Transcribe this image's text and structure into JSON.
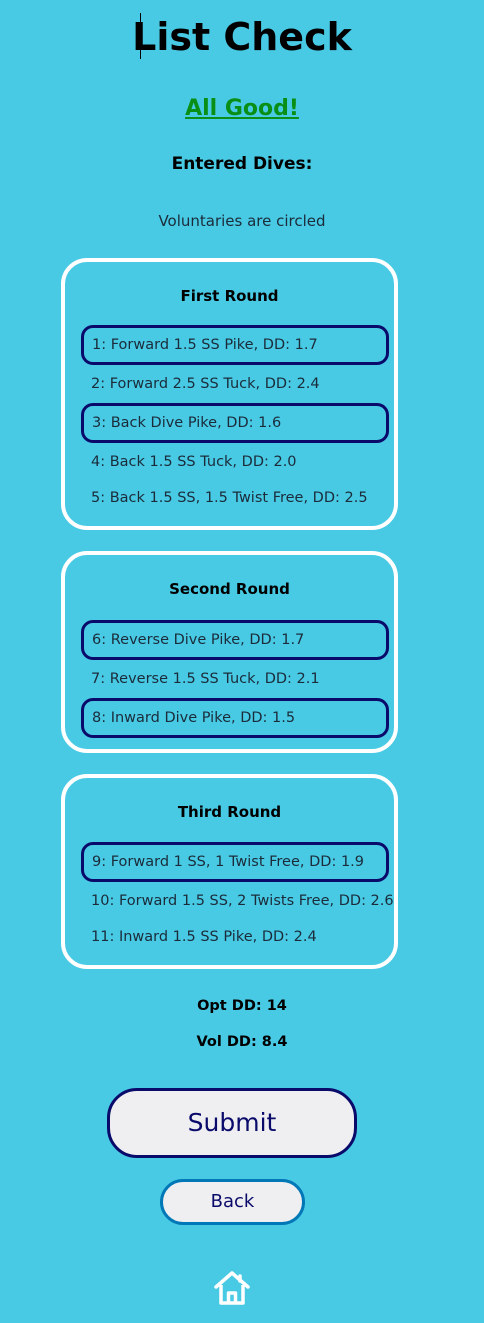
{
  "page": {
    "title": "List Check",
    "status": "All Good!",
    "entered_heading": "Entered Dives:",
    "note": "Voluntaries are circled"
  },
  "rounds": [
    {
      "title": "First Round",
      "dives": [
        {
          "label": "1: Forward 1.5 SS Pike, DD: 1.7",
          "voluntary": true
        },
        {
          "label": "2: Forward 2.5 SS Tuck, DD: 2.4",
          "voluntary": false
        },
        {
          "label": "3: Back Dive Pike, DD: 1.6",
          "voluntary": true
        },
        {
          "label": "4: Back 1.5 SS Tuck, DD: 2.0",
          "voluntary": false
        },
        {
          "label": "5: Back 1.5 SS, 1.5 Twist Free, DD: 2.5",
          "voluntary": false
        }
      ]
    },
    {
      "title": "Second Round",
      "dives": [
        {
          "label": "6: Reverse Dive Pike, DD: 1.7",
          "voluntary": true
        },
        {
          "label": "7: Reverse 1.5 SS Tuck, DD: 2.1",
          "voluntary": false
        },
        {
          "label": "8: Inward Dive Pike, DD: 1.5",
          "voluntary": true
        }
      ]
    },
    {
      "title": "Third Round",
      "dives": [
        {
          "label": "9: Forward 1 SS, 1 Twist Free, DD: 1.9",
          "voluntary": true
        },
        {
          "label": "10: Forward 1.5 SS, 2 Twists Free, DD: 2.6",
          "voluntary": false
        },
        {
          "label": "11: Inward 1.5 SS Pike, DD: 2.4",
          "voluntary": false
        }
      ]
    }
  ],
  "totals": {
    "opt_dd": "Opt DD: 14",
    "vol_dd": "Vol DD: 8.4"
  },
  "buttons": {
    "submit": "Submit",
    "back": "Back"
  },
  "icons": {
    "home": "home-icon"
  },
  "colors": {
    "background": "#48CAE4",
    "status": "#0a8f16",
    "voluntary_border": "#0a0a6b",
    "round_border": "#ffffff"
  }
}
